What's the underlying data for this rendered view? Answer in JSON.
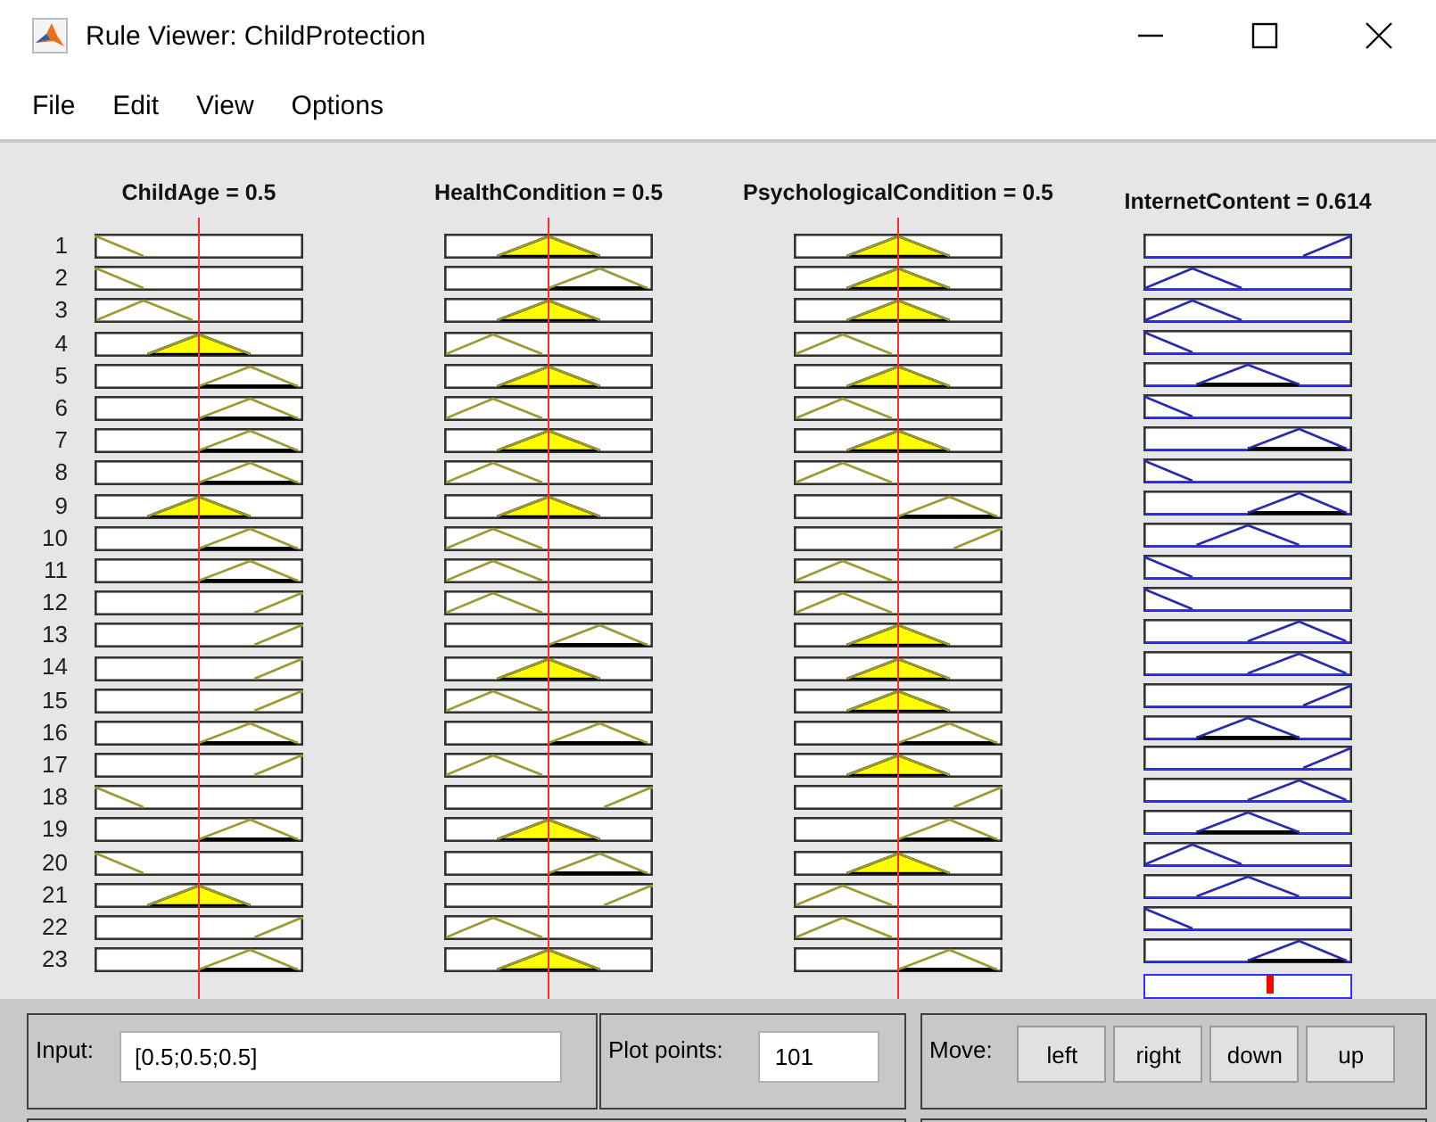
{
  "window": {
    "title": "Rule Viewer: ChildProtection"
  },
  "menu": [
    "File",
    "Edit",
    "View",
    "Options"
  ],
  "variables": [
    {
      "kind": "input",
      "label": "ChildAge = 0.5"
    },
    {
      "kind": "input",
      "label": "HealthCondition = 0.5"
    },
    {
      "kind": "input",
      "label": "PsychologicalCondition = 0.5"
    },
    {
      "kind": "output",
      "label": "InternetContent = 0.614"
    }
  ],
  "rules": [
    {
      "number": "1",
      "cells": [
        {
          "kind": "low"
        },
        {
          "kind": "mid"
        },
        {
          "kind": "mid"
        },
        {
          "kind": "high"
        }
      ]
    },
    {
      "number": "2",
      "cells": [
        {
          "kind": "low"
        },
        {
          "kind": "mid_high"
        },
        {
          "kind": "mid"
        },
        {
          "kind": "mid_low"
        }
      ]
    },
    {
      "number": "3",
      "cells": [
        {
          "kind": "mid_low"
        },
        {
          "kind": "mid"
        },
        {
          "kind": "mid"
        },
        {
          "kind": "mid_low"
        }
      ]
    },
    {
      "number": "4",
      "cells": [
        {
          "kind": "mid"
        },
        {
          "kind": "mid_low"
        },
        {
          "kind": "mid_low"
        },
        {
          "kind": "low"
        }
      ]
    },
    {
      "number": "5",
      "cells": [
        {
          "kind": "mid_high"
        },
        {
          "kind": "mid"
        },
        {
          "kind": "mid"
        },
        {
          "kind": "mid"
        }
      ]
    },
    {
      "number": "6",
      "cells": [
        {
          "kind": "mid_high"
        },
        {
          "kind": "mid_low"
        },
        {
          "kind": "mid_low"
        },
        {
          "kind": "low"
        }
      ]
    },
    {
      "number": "7",
      "cells": [
        {
          "kind": "mid_high"
        },
        {
          "kind": "mid"
        },
        {
          "kind": "mid"
        },
        {
          "kind": "mid_high"
        }
      ]
    },
    {
      "number": "8",
      "cells": [
        {
          "kind": "mid_high"
        },
        {
          "kind": "mid_low"
        },
        {
          "kind": "mid_low"
        },
        {
          "kind": "low"
        }
      ]
    },
    {
      "number": "9",
      "cells": [
        {
          "kind": "mid"
        },
        {
          "kind": "mid"
        },
        {
          "kind": "mid_high"
        },
        {
          "kind": "mid_high"
        }
      ]
    },
    {
      "number": "10",
      "cells": [
        {
          "kind": "mid_high"
        },
        {
          "kind": "mid_low"
        },
        {
          "kind": "high"
        },
        {
          "kind": "mid"
        }
      ]
    },
    {
      "number": "11",
      "cells": [
        {
          "kind": "mid_high"
        },
        {
          "kind": "mid_low"
        },
        {
          "kind": "mid_low"
        },
        {
          "kind": "low"
        }
      ]
    },
    {
      "number": "12",
      "cells": [
        {
          "kind": "high"
        },
        {
          "kind": "mid_low"
        },
        {
          "kind": "mid_low"
        },
        {
          "kind": "low"
        }
      ]
    },
    {
      "number": "13",
      "cells": [
        {
          "kind": "high"
        },
        {
          "kind": "mid_high"
        },
        {
          "kind": "mid"
        },
        {
          "kind": "mid_high"
        }
      ]
    },
    {
      "number": "14",
      "cells": [
        {
          "kind": "high"
        },
        {
          "kind": "mid"
        },
        {
          "kind": "mid"
        },
        {
          "kind": "mid_high"
        }
      ]
    },
    {
      "number": "15",
      "cells": [
        {
          "kind": "high"
        },
        {
          "kind": "mid_low"
        },
        {
          "kind": "mid"
        },
        {
          "kind": "high"
        }
      ]
    },
    {
      "number": "16",
      "cells": [
        {
          "kind": "mid_high"
        },
        {
          "kind": "mid_high"
        },
        {
          "kind": "mid_high"
        },
        {
          "kind": "mid"
        }
      ]
    },
    {
      "number": "17",
      "cells": [
        {
          "kind": "high"
        },
        {
          "kind": "mid_low"
        },
        {
          "kind": "mid"
        },
        {
          "kind": "high"
        }
      ]
    },
    {
      "number": "18",
      "cells": [
        {
          "kind": "low"
        },
        {
          "kind": "high"
        },
        {
          "kind": "high"
        },
        {
          "kind": "mid_high"
        }
      ]
    },
    {
      "number": "19",
      "cells": [
        {
          "kind": "mid_high"
        },
        {
          "kind": "mid"
        },
        {
          "kind": "mid_high"
        },
        {
          "kind": "mid"
        }
      ]
    },
    {
      "number": "20",
      "cells": [
        {
          "kind": "low"
        },
        {
          "kind": "mid_high"
        },
        {
          "kind": "mid"
        },
        {
          "kind": "mid_low"
        }
      ]
    },
    {
      "number": "21",
      "cells": [
        {
          "kind": "mid"
        },
        {
          "kind": "high"
        },
        {
          "kind": "mid_low"
        },
        {
          "kind": "mid"
        }
      ]
    },
    {
      "number": "22",
      "cells": [
        {
          "kind": "high"
        },
        {
          "kind": "mid_low"
        },
        {
          "kind": "mid_low"
        },
        {
          "kind": "low"
        }
      ]
    },
    {
      "number": "23",
      "cells": [
        {
          "kind": "mid_high"
        },
        {
          "kind": "mid"
        },
        {
          "kind": "mid_high"
        },
        {
          "kind": "mid_high"
        }
      ]
    }
  ],
  "input": {
    "label": "Input:",
    "value": "[0.5;0.5;0.5]"
  },
  "plot_points": {
    "label": "Plot points:",
    "value": "101"
  },
  "move": {
    "label": "Move:",
    "buttons": [
      "left",
      "right",
      "down",
      "up"
    ]
  }
}
